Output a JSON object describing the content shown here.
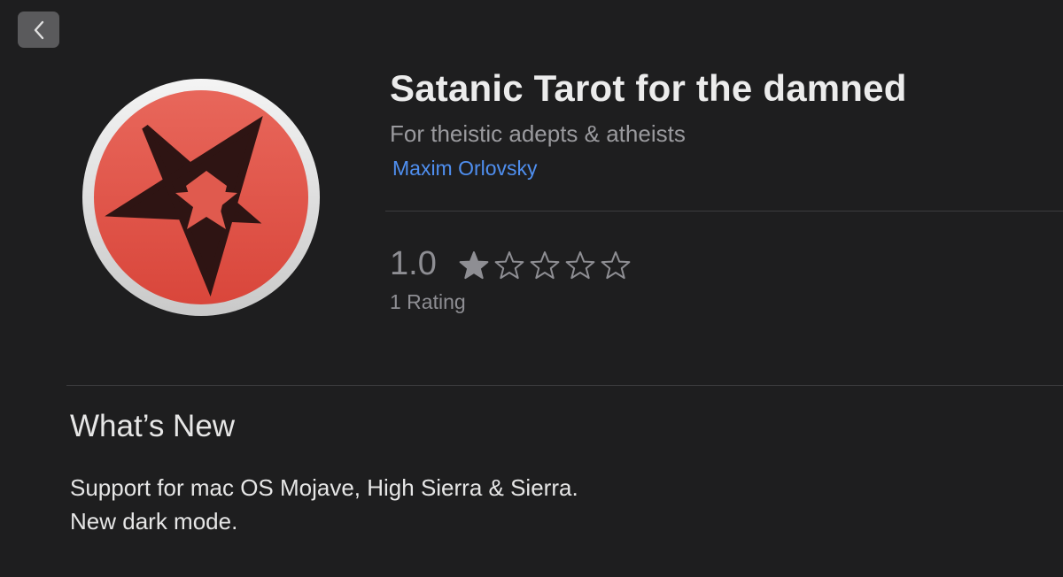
{
  "app": {
    "title": "Satanic Tarot for the damned",
    "subtitle": "For theistic adepts & atheists",
    "developer": "Maxim Orlovsky",
    "icon": "red-pentagram-icon"
  },
  "rating": {
    "value": "1.0",
    "stars_filled": 1,
    "stars_total": 5,
    "count_label": "1 Rating"
  },
  "whats_new": {
    "title": "What’s New",
    "lines": [
      "Support for mac OS Mojave, High Sierra & Sierra.",
      "New dark mode."
    ]
  },
  "nav": {
    "back_icon": "chevron-left-icon"
  },
  "colors": {
    "background": "#1e1e1f",
    "accent_link": "#4f8ff0",
    "icon_red": "#e4564a"
  }
}
